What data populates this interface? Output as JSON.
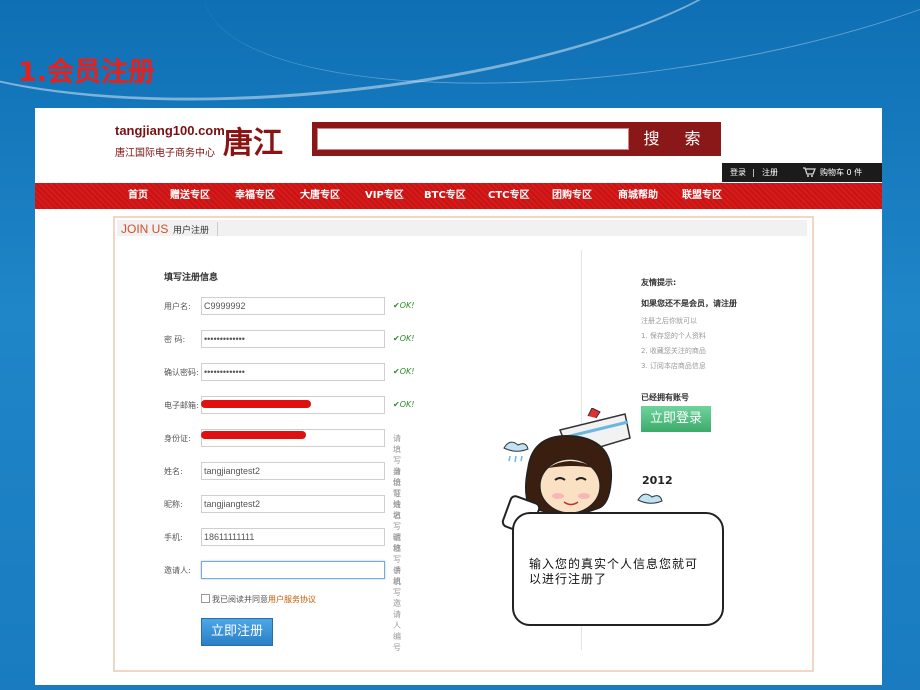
{
  "slide": {
    "title": "1.会员注册"
  },
  "header": {
    "logo_en": "tangjiang100.com",
    "logo_cn": "唐江国际电子商务中心",
    "logo_mark": "唐江",
    "search_button": "搜 索",
    "login": "登录",
    "separator": "|",
    "register": "注册",
    "cart": "购物车 0 件"
  },
  "nav": [
    "首页",
    "赠送专区",
    "幸福专区",
    "大唐专区",
    "VIP专区",
    "BTC专区",
    "CTC专区",
    "团购专区",
    "商城帮助",
    "联盟专区"
  ],
  "panel": {
    "tab_en": "JOIN US",
    "tab_cn": "用户注册",
    "form_title": "填写注册信息",
    "fields": [
      {
        "label": "用户名:",
        "value": "C9999992",
        "status": "OK!",
        "hint": ""
      },
      {
        "label": "密  码:",
        "value": "•••••••••••••",
        "status": "OK!",
        "hint": ""
      },
      {
        "label": "确认密码:",
        "value": "•••••••••••••",
        "status": "OK!",
        "hint": ""
      },
      {
        "label": "电子邮箱:",
        "value": "",
        "status": "OK!",
        "hint": ""
      },
      {
        "label": "身份证:",
        "value": "",
        "status": "",
        "hint": "请填写身份证"
      },
      {
        "label": "姓名:",
        "value": "tangjiangtest2",
        "status": "",
        "hint": "请填写姓名"
      },
      {
        "label": "昵称:",
        "value": "tangjiangtest2",
        "status": "",
        "hint": "请填写昵称"
      },
      {
        "label": "手机:",
        "value": "18611111111",
        "status": "",
        "hint": "请填写手机"
      },
      {
        "label": "邀请人:",
        "value": "",
        "status": "",
        "hint": "请填写邀请人编号"
      }
    ],
    "agree_text": "我已阅读并同意",
    "agree_link": "用户服务协议",
    "submit": "立即注册"
  },
  "tips": {
    "title": "友情提示:",
    "bold": "如果您还不是会员，请注册",
    "lines": [
      "注册之后你就可以",
      "1. 保存您的个人资料",
      "2. 收藏您关注的商品",
      "3. 订阅本店商品信息"
    ],
    "have_account": "已经拥有账号",
    "login_button": "立即登录"
  },
  "mascot": {
    "bubble_text": "输入您的真实个人信息您就可以进行注册了",
    "year": "2012"
  },
  "colors": {
    "brand_red": "#8b1818",
    "nav_red": "#d81a1a",
    "ok_green": "#2e8a2e",
    "slide_title": "#e8201c"
  }
}
